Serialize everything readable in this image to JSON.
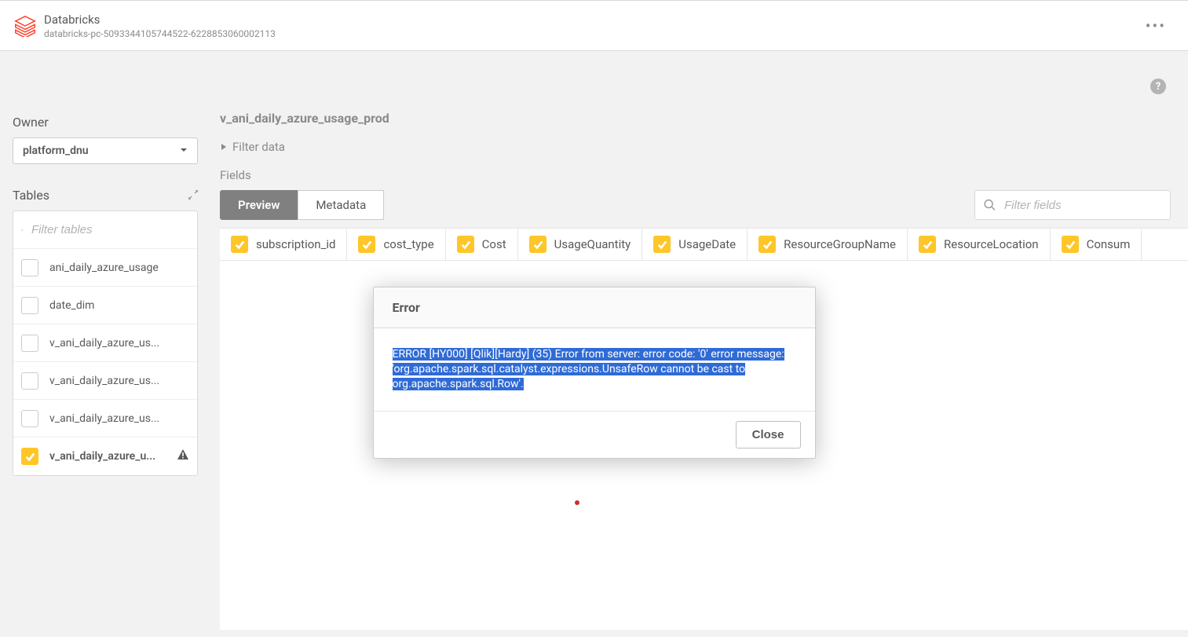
{
  "header": {
    "title": "Databricks",
    "subtitle": "databricks-pc-5093344105744522-6228853060002113"
  },
  "help": {
    "glyph": "?"
  },
  "sidebar": {
    "owner_label": "Owner",
    "owner_value": "platform_dnu",
    "tables_label": "Tables",
    "filter_placeholder": "Filter tables",
    "items": [
      {
        "name": "ani_daily_azure_usage",
        "checked": false,
        "warn": false
      },
      {
        "name": "date_dim",
        "checked": false,
        "warn": false
      },
      {
        "name": "v_ani_daily_azure_us...",
        "checked": false,
        "warn": false
      },
      {
        "name": "v_ani_daily_azure_us...",
        "checked": false,
        "warn": false
      },
      {
        "name": "v_ani_daily_azure_us...",
        "checked": false,
        "warn": false
      },
      {
        "name": "v_ani_daily_azure_u...",
        "checked": true,
        "warn": true
      }
    ]
  },
  "main": {
    "title": "v_ani_daily_azure_usage_prod",
    "filter_data_label": "Filter data",
    "fields_label": "Fields",
    "tabs": {
      "preview": "Preview",
      "metadata": "Metadata"
    },
    "filter_fields_placeholder": "Filter fields",
    "fields": [
      "subscription_id",
      "cost_type",
      "Cost",
      "UsageQuantity",
      "UsageDate",
      "ResourceGroupName",
      "ResourceLocation",
      "Consum"
    ]
  },
  "modal": {
    "title": "Error",
    "message": "ERROR [HY000] [Qlik][Hardy] (35) Error from server: error code: '0' error message: 'org.apache.spark.sql.catalyst.expressions.UnsafeRow cannot be cast to org.apache.spark.sql.Row'.",
    "close_label": "Close"
  }
}
